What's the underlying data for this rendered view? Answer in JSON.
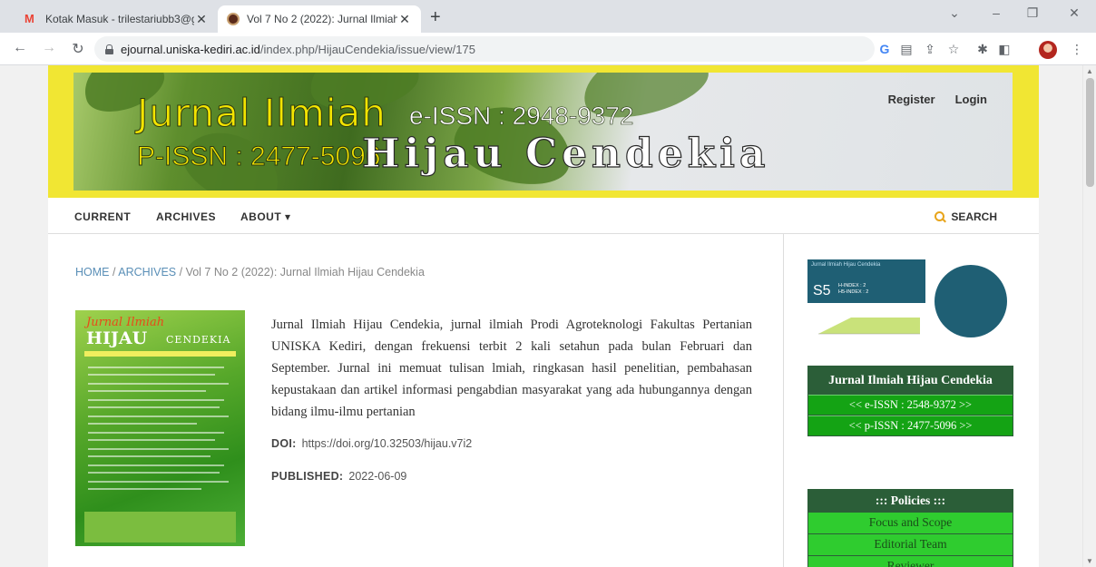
{
  "browser": {
    "tabs": [
      {
        "title": "Kotak Masuk - trilestariubb3@gm",
        "icon": "gmail-icon"
      },
      {
        "title": "Vol 7 No 2 (2022): Jurnal Ilmiah H",
        "icon": "site-favicon"
      }
    ],
    "url_host": "ejournal.uniska-kediri.ac.id",
    "url_path": "/index.php/HijauCendekia/issue/view/175"
  },
  "header": {
    "title_line1": "Jurnal Ilmiah",
    "eissn": "e-ISSN : 2948-9372",
    "pissn": "P-ISSN : 2477-5096",
    "title_line2": "Hijau Cendekia",
    "register": "Register",
    "login": "Login",
    "banner_color": "#f1e633"
  },
  "nav": {
    "current": "CURRENT",
    "archives": "ARCHIVES",
    "about": "ABOUT ▾",
    "search": "SEARCH"
  },
  "breadcrumb": {
    "home": "HOME",
    "sep1": " / ",
    "archives": "ARCHIVES",
    "sep2": " / ",
    "current": "Vol 7 No 2 (2022): Jurnal Ilmiah Hijau Cendekia"
  },
  "cover": {
    "title_italic": "Jurnal Ilmiah",
    "title_main": "HIJAU",
    "title_sub": "CENDEKIA"
  },
  "issue": {
    "description": "Jurnal Ilmiah Hijau Cendekia, jurnal ilmiah Prodi Agroteknologi Fakultas Pertanian UNISKA Kediri, dengan frekuensi terbit 2 kali setahun pada bulan Februari dan September. Jurnal  ini memuat tulisan lmiah, ringkasan hasil penelitian, pembahasan kepustakaan dan artikel informasi pengabdian masyarakat yang ada hubungannya dengan bidang ilmu-ilmu pertanian",
    "doi_label": "DOI:",
    "doi_value": "https://doi.org/10.32503/hijau.v7i2",
    "published_label": "PUBLISHED:",
    "published_value": "2022-06-09"
  },
  "sidebar": {
    "hindex": {
      "title": "Jurnal Ilmiah Hijau Cendekia",
      "rank": "S5",
      "h_index": "H-INDEX : 2",
      "h5_index": "H5-INDEX : 2"
    },
    "journal_block": {
      "title": "Jurnal Ilmiah Hijau Cendekia",
      "eissn": "<< e-ISSN : 2548-9372 >>",
      "pissn": "<< p-ISSN : 2477-5096 >>"
    },
    "policies": {
      "title": ":::  Policies  :::",
      "items": [
        "Focus and Scope",
        "Editorial Team",
        "Reviewer"
      ]
    }
  }
}
